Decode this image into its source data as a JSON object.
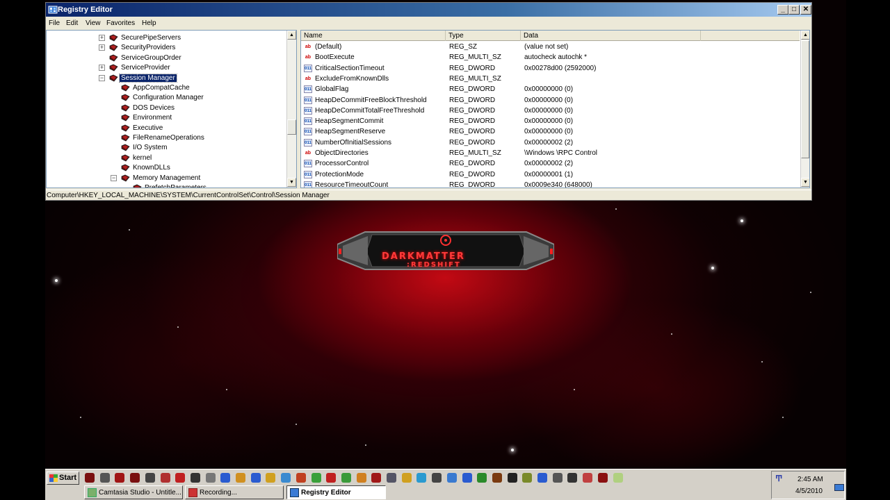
{
  "window": {
    "title": "Registry Editor",
    "controls": {
      "minimize": "_",
      "maximize": "□",
      "close": "✕"
    }
  },
  "menu": [
    "File",
    "Edit",
    "View",
    "Favorites",
    "Help"
  ],
  "tree": {
    "nodes": [
      {
        "label": "SecurePipeServers",
        "expander": "+",
        "selected": false
      },
      {
        "label": "SecurityProviders",
        "expander": "+",
        "selected": false
      },
      {
        "label": "ServiceGroupOrder",
        "expander": "",
        "selected": false
      },
      {
        "label": "ServiceProvider",
        "expander": "+",
        "selected": false
      },
      {
        "label": "Session Manager",
        "expander": "−",
        "selected": true
      },
      {
        "label": "AppCompatCache",
        "expander": "",
        "selected": false
      },
      {
        "label": "Configuration Manager",
        "expander": "",
        "selected": false
      },
      {
        "label": "DOS Devices",
        "expander": "",
        "selected": false
      },
      {
        "label": "Environment",
        "expander": "",
        "selected": false
      },
      {
        "label": "Executive",
        "expander": "",
        "selected": false
      },
      {
        "label": "FileRenameOperations",
        "expander": "",
        "selected": false
      },
      {
        "label": "I/O System",
        "expander": "",
        "selected": false
      },
      {
        "label": "kernel",
        "expander": "",
        "selected": false
      },
      {
        "label": "KnownDLLs",
        "expander": "",
        "selected": false
      },
      {
        "label": "Memory Management",
        "expander": "−",
        "selected": false
      },
      {
        "label": "PrefetchParameters",
        "expander": "",
        "selected": false
      }
    ]
  },
  "list": {
    "columns": [
      "Name",
      "Type",
      "Data"
    ],
    "rows": [
      {
        "icon": "ab",
        "name": "(Default)",
        "type": "REG_SZ",
        "data": "(value not set)"
      },
      {
        "icon": "ab",
        "name": "BootExecute",
        "type": "REG_MULTI_SZ",
        "data": "autocheck autochk *"
      },
      {
        "icon": "011",
        "name": "CriticalSectionTimeout",
        "type": "REG_DWORD",
        "data": "0x00278d00 (2592000)"
      },
      {
        "icon": "ab",
        "name": "ExcludeFromKnownDlls",
        "type": "REG_MULTI_SZ",
        "data": ""
      },
      {
        "icon": "011",
        "name": "GlobalFlag",
        "type": "REG_DWORD",
        "data": "0x00000000 (0)"
      },
      {
        "icon": "011",
        "name": "HeapDeCommitFreeBlockThreshold",
        "type": "REG_DWORD",
        "data": "0x00000000 (0)"
      },
      {
        "icon": "011",
        "name": "HeapDeCommitTotalFreeThreshold",
        "type": "REG_DWORD",
        "data": "0x00000000 (0)"
      },
      {
        "icon": "011",
        "name": "HeapSegmentCommit",
        "type": "REG_DWORD",
        "data": "0x00000000 (0)"
      },
      {
        "icon": "011",
        "name": "HeapSegmentReserve",
        "type": "REG_DWORD",
        "data": "0x00000000 (0)"
      },
      {
        "icon": "011",
        "name": "NumberOfInitialSessions",
        "type": "REG_DWORD",
        "data": "0x00000002 (2)"
      },
      {
        "icon": "ab",
        "name": "ObjectDirectories",
        "type": "REG_MULTI_SZ",
        "data": "\\Windows \\RPC Control"
      },
      {
        "icon": "011",
        "name": "ProcessorControl",
        "type": "REG_DWORD",
        "data": "0x00000002 (2)"
      },
      {
        "icon": "011",
        "name": "ProtectionMode",
        "type": "REG_DWORD",
        "data": "0x00000001 (1)"
      },
      {
        "icon": "011",
        "name": "ResourceTimeoutCount",
        "type": "REG_DWORD",
        "data": "0x0009e340 (648000)"
      }
    ]
  },
  "statusbar": {
    "path": "Computer\\HKEY_LOCAL_MACHINE\\SYSTEM\\CurrentControlSet\\Control\\Session Manager"
  },
  "desktop": {
    "logo_line1": "DARKMATTER",
    "logo_line2": ":REDSHIFT"
  },
  "taskbar": {
    "start_label": "Start",
    "tasks": [
      {
        "label": "Camtasia Studio - Untitle...",
        "active": false
      },
      {
        "label": "Recording...",
        "active": false
      },
      {
        "label": "Registry Editor",
        "active": true
      }
    ],
    "clock": "2:45 AM",
    "date": "4/5/2010"
  },
  "colors": {
    "selection": "#0a246a",
    "title_start": "#0a246a",
    "title_end": "#a6caf0",
    "desktop_accent": "#c00a14"
  }
}
